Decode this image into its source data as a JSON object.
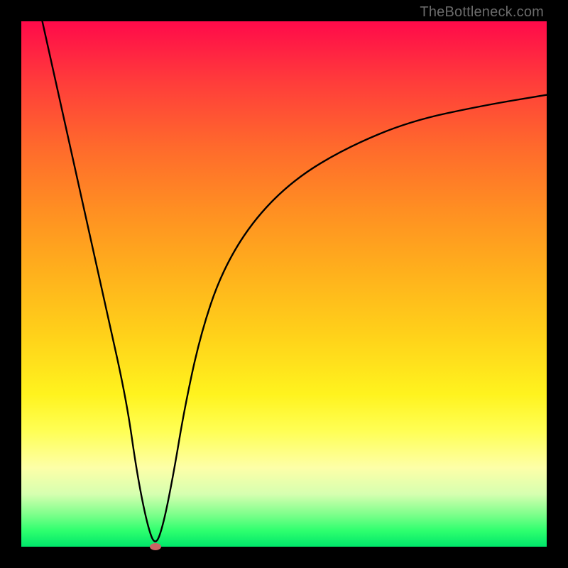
{
  "attribution": "TheBottleneck.com",
  "colors": {
    "frame_background": "#000000",
    "gradient_top": "#ff0a4a",
    "gradient_bottom": "#00e66a",
    "curve_stroke": "#000000",
    "marker_fill": "#c96464",
    "attribution_text": "#6b6b6b"
  },
  "chart_data": {
    "type": "line",
    "title": "",
    "xlabel": "",
    "ylabel": "",
    "xlim": [
      0,
      100
    ],
    "ylim": [
      0,
      100
    ],
    "series": [
      {
        "name": "bottleneck-curve",
        "x": [
          4,
          8,
          12,
          16,
          20,
          22,
          24,
          25.5,
          27,
          29,
          31,
          34,
          38,
          44,
          52,
          62,
          74,
          88,
          100
        ],
        "values": [
          100,
          82,
          64,
          46,
          28,
          14,
          4,
          0,
          4,
          14,
          26,
          40,
          52,
          62,
          70,
          76,
          81,
          84,
          86
        ]
      }
    ],
    "marker": {
      "x": 25.5,
      "y": 0
    },
    "grid": false,
    "legend": false
  }
}
